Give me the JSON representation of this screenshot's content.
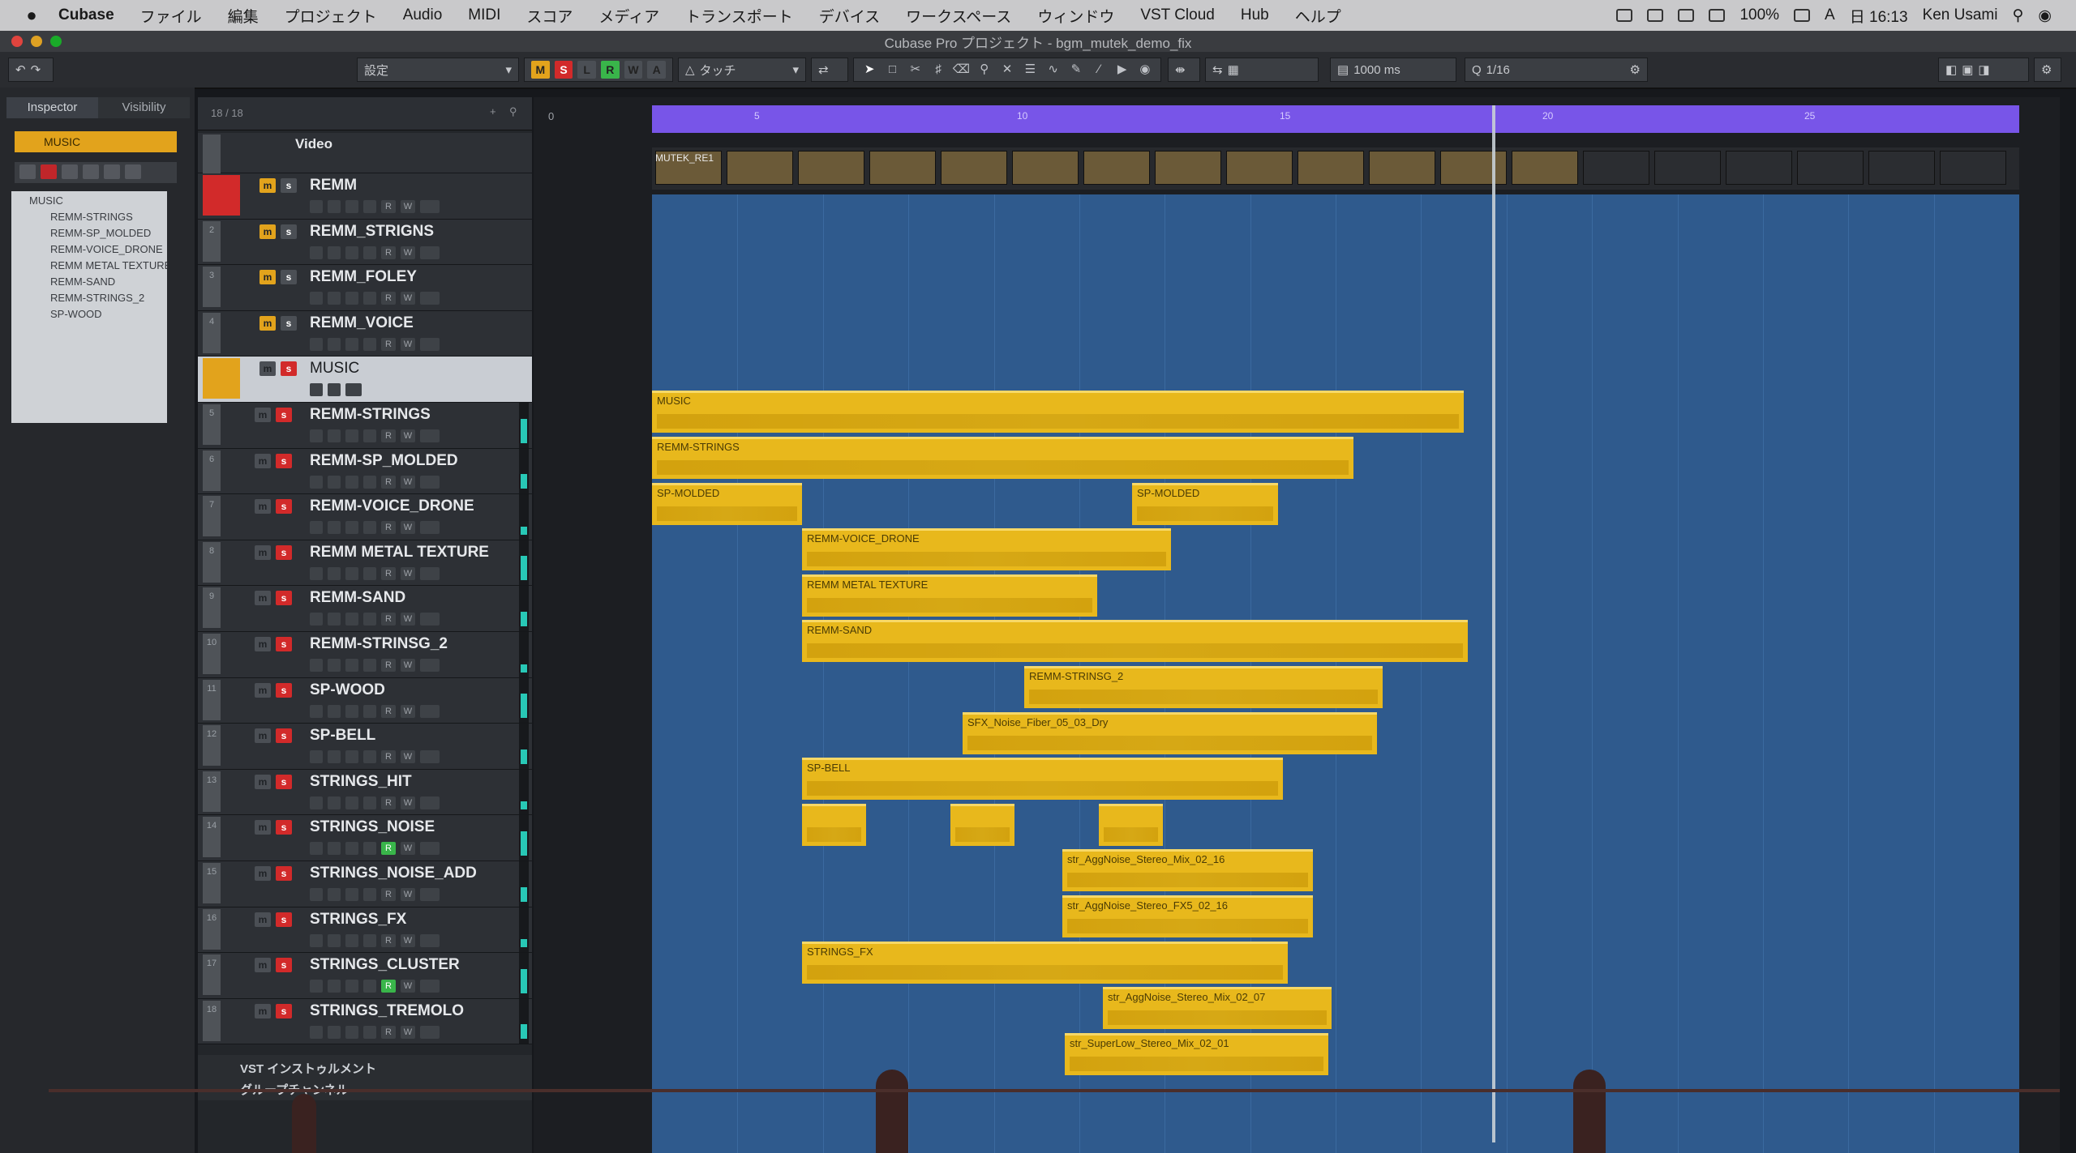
{
  "menubar": {
    "app": "Cubase",
    "items": [
      "ファイル",
      "編集",
      "プロジェクト",
      "Audio",
      "MIDI",
      "スコア",
      "メディア",
      "トランスポート",
      "デバイス",
      "ワークスペース",
      "ウィンドウ",
      "VST Cloud",
      "Hub",
      "ヘルプ"
    ],
    "battery": "100%",
    "input": "A",
    "clock": "日 16:13",
    "user": "Ken Usami"
  },
  "window": {
    "title": "Cubase Pro プロジェクト - bgm_mutek_demo_fix"
  },
  "toolbar": {
    "preset": "設定",
    "buttons": [
      "M",
      "S",
      "L",
      "R",
      "W",
      "A"
    ],
    "automation_mode": "タッチ",
    "nudge": "1000 ms",
    "quantize": "1/16"
  },
  "inspector": {
    "tabs": [
      "Inspector",
      "Visibility"
    ],
    "selected_track": "MUSIC",
    "folder_root": "MUSIC",
    "folder_items": [
      "REMM-STRINGS",
      "REMM-SP_MOLDED",
      "REMM-VOICE_DRONE",
      "REMM METAL TEXTURE",
      "REMM-SAND",
      "REMM-STRINGS_2",
      "SP-WOOD"
    ]
  },
  "tracklist": {
    "counter": "18 / 18",
    "tracks": [
      {
        "num": "",
        "name": "Video",
        "kind": "video"
      },
      {
        "num": "",
        "name": "REMM",
        "kind": "folder-red"
      },
      {
        "num": "2",
        "name": "REMM_STRIGNS",
        "kind": "yellow"
      },
      {
        "num": "3",
        "name": "REMM_FOLEY",
        "kind": "yellow"
      },
      {
        "num": "4",
        "name": "REMM_VOICE",
        "kind": "yellow"
      },
      {
        "num": "",
        "name": "MUSIC",
        "kind": "folder-hl"
      },
      {
        "num": "5",
        "name": "REMM-STRINGS",
        "kind": "audio"
      },
      {
        "num": "6",
        "name": "REMM-SP_MOLDED",
        "kind": "audio"
      },
      {
        "num": "7",
        "name": "REMM-VOICE_DRONE",
        "kind": "audio"
      },
      {
        "num": "8",
        "name": "REMM METAL TEXTURE",
        "kind": "audio"
      },
      {
        "num": "9",
        "name": "REMM-SAND",
        "kind": "audio"
      },
      {
        "num": "10",
        "name": "REMM-STRINSG_2",
        "kind": "audio"
      },
      {
        "num": "11",
        "name": "SP-WOOD",
        "kind": "audio"
      },
      {
        "num": "12",
        "name": "SP-BELL",
        "kind": "audio"
      },
      {
        "num": "13",
        "name": "STRINGS_HIT",
        "kind": "audio"
      },
      {
        "num": "14",
        "name": "STRINGS_NOISE",
        "kind": "audio",
        "rec": true
      },
      {
        "num": "15",
        "name": "STRINGS_NOISE_ADD",
        "kind": "audio"
      },
      {
        "num": "16",
        "name": "STRINGS_FX",
        "kind": "audio"
      },
      {
        "num": "17",
        "name": "STRINGS_CLUSTER",
        "kind": "audio",
        "rec": true
      },
      {
        "num": "18",
        "name": "STRINGS_TREMOLO",
        "kind": "audio"
      }
    ],
    "footer": [
      "VST インストゥルメント",
      "グループチャンネル"
    ]
  },
  "arrange": {
    "ruler_start": "0",
    "ruler_marks": [
      "5",
      "10",
      "15",
      "20",
      "25"
    ],
    "video_clip": "MUTEK_RE1",
    "events": [
      {
        "label": "MUSIC",
        "row": 5,
        "start": 0,
        "end": 0.594
      },
      {
        "label": "REMM-STRINGS",
        "row": 6,
        "start": 0,
        "end": 0.513
      },
      {
        "label": "SP-MOLDED",
        "row": 7,
        "start": 0,
        "end": 0.11
      },
      {
        "label": "SP-MOLDED",
        "row": 7,
        "start": 0.351,
        "end": 0.458
      },
      {
        "label": "REMM-VOICE_DRONE",
        "row": 8,
        "start": 0.11,
        "end": 0.38
      },
      {
        "label": "REMM METAL TEXTURE",
        "row": 9,
        "start": 0.11,
        "end": 0.326
      },
      {
        "label": "REMM-SAND",
        "row": 10,
        "start": 0.11,
        "end": 0.597
      },
      {
        "label": "REMM-STRINSG_2",
        "row": 11,
        "start": 0.272,
        "end": 0.534
      },
      {
        "label": "SFX_Noise_Fiber_05_03_Dry",
        "row": 12,
        "start": 0.227,
        "end": 0.53
      },
      {
        "label": "SP-BELL",
        "row": 13,
        "start": 0.11,
        "end": 0.462
      },
      {
        "label": "",
        "row": 14,
        "start": 0.11,
        "end": 0.157
      },
      {
        "label": "",
        "row": 14,
        "start": 0.218,
        "end": 0.265
      },
      {
        "label": "",
        "row": 14,
        "start": 0.327,
        "end": 0.374
      },
      {
        "label": "str_AggNoise_Stereo_Mix_02_16",
        "row": 15,
        "start": 0.3,
        "end": 0.483
      },
      {
        "label": "str_AggNoise_Stereo_FX5_02_16",
        "row": 16,
        "start": 0.3,
        "end": 0.483
      },
      {
        "label": "STRINGS_FX",
        "row": 17,
        "start": 0.11,
        "end": 0.465
      },
      {
        "label": "str_AggNoise_Stereo_Mix_02_07",
        "row": 18,
        "start": 0.33,
        "end": 0.497
      },
      {
        "label": "str_SuperLow_Stereo_Mix_02_01",
        "row": 19,
        "start": 0.302,
        "end": 0.495
      }
    ]
  },
  "colors": {
    "event": "#e8b81c",
    "lane": "#2f5a8d",
    "ruler": "#7855e8",
    "record": "#d22a2a",
    "meter": "#28c8b6"
  }
}
